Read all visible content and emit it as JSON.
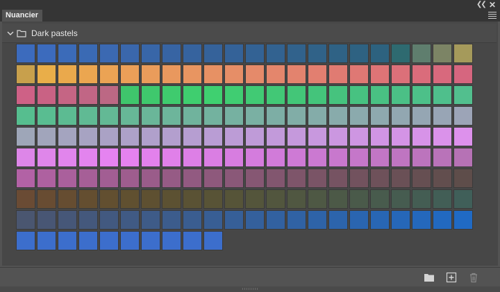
{
  "panel": {
    "tab_title": "Nuancier",
    "group_name": "Dark pastels"
  },
  "icons": {
    "collapse": "double-chevron-left-icon",
    "close": "close-icon",
    "menu": "hamburger-menu-icon",
    "expand": "chevron-down-icon",
    "folder": "folder-icon",
    "new_group": "new-folder-icon",
    "new_swatch": "add-icon",
    "delete": "trash-icon"
  },
  "swatches": [
    "#3c6bbd",
    "#3c6bbd",
    "#3b6bb9",
    "#3a6ab4",
    "#3b69b2",
    "#3a67ac",
    "#3866a8",
    "#3764a3",
    "#36639e",
    "#35629a",
    "#346298",
    "#336294",
    "#326290",
    "#31628c",
    "#306288",
    "#2f6285",
    "#2e6282",
    "#2d627f",
    "#2e6a70",
    "#5f7e6e",
    "#7c8465",
    "#a59a5b",
    "#c8a04c",
    "#e9ae49",
    "#eaa94c",
    "#eba650",
    "#eba354",
    "#eb9f58",
    "#ea9c5b",
    "#e9985e",
    "#e89561",
    "#e79164",
    "#e68e67",
    "#e58a6a",
    "#e4866c",
    "#e3836e",
    "#e27f70",
    "#e07b72",
    "#df7874",
    "#de7476",
    "#dc7079",
    "#da6c7b",
    "#d8697d",
    "#d6667f",
    "#ce6186",
    "#c96284",
    "#c56584",
    "#c16685",
    "#bc6884",
    "#3fc56c",
    "#3fc86d",
    "#3fcb6e",
    "#3fce6f",
    "#3fd070",
    "#40cd72",
    "#41ca74",
    "#42c876",
    "#43c678",
    "#44c47b",
    "#46c37e",
    "#47c281",
    "#49c183",
    "#4bc086",
    "#4dc089",
    "#4fbf8c",
    "#52bf8e",
    "#56be8f",
    "#59bd91",
    "#5cbb92",
    "#60ba94",
    "#63b995",
    "#67b797",
    "#6ab699",
    "#6db59b",
    "#70b39d",
    "#73b29f",
    "#76b1a1",
    "#7ab0a3",
    "#7daea5",
    "#81ada7",
    "#84aca9",
    "#88abab",
    "#8baaad",
    "#8ea9af",
    "#92a7b1",
    "#95a6b3",
    "#98a5b5",
    "#9ca4b7",
    "#9ea6b8",
    "#a1a5bb",
    "#a4a4bf",
    "#a7a3c2",
    "#aaa2c5",
    "#ada1c8",
    "#b0a0cb",
    "#b39fce",
    "#b69ed1",
    "#b99dd4",
    "#bc9cd6",
    "#bf9bd8",
    "#c29ada",
    "#c599dc",
    "#c898de",
    "#cb97e0",
    "#ce96e2",
    "#d195e4",
    "#d494e6",
    "#d793e8",
    "#da92ea",
    "#dd91ec",
    "#dd86e8",
    "#df86ea",
    "#e185ec",
    "#e384ee",
    "#e583f0",
    "#e582ef",
    "#e381ec",
    "#e080e9",
    "#dd7fe6",
    "#da7ee3",
    "#d77de0",
    "#d47cdd",
    "#d17bd9",
    "#ce7ad5",
    "#cb79d1",
    "#c878cd",
    "#c577c9",
    "#c276c5",
    "#bf75c1",
    "#bc74bd",
    "#b973b9",
    "#b672b5",
    "#b262a5",
    "#ae61a0",
    "#aa609c",
    "#a65f97",
    "#a25e93",
    "#9e5d8e",
    "#9a5c8a",
    "#965b85",
    "#925a81",
    "#8e597c",
    "#8a5878",
    "#865773",
    "#82566f",
    "#7e556a",
    "#7a5466",
    "#765362",
    "#72525e",
    "#6e515a",
    "#6a5056",
    "#664f52",
    "#624e4e",
    "#5e4d4a",
    "#6a4b34",
    "#684c32",
    "#664d31",
    "#644e30",
    "#624f30",
    "#605030",
    "#5e5031",
    "#5c5132",
    "#5a5234",
    "#585336",
    "#565438",
    "#54553b",
    "#52563e",
    "#505741",
    "#4e5844",
    "#4c5947",
    "#4a5a4a",
    "#485b4d",
    "#465c50",
    "#445d53",
    "#425e56",
    "#405f59",
    "#4a5670",
    "#485674",
    "#465778",
    "#44587c",
    "#425980",
    "#405a84",
    "#3e5b88",
    "#3c5c8c",
    "#3a5d90",
    "#385e94",
    "#365f98",
    "#34609c",
    "#3261a0",
    "#3062a4",
    "#2e63a8",
    "#2c64ac",
    "#2a65b0",
    "#2866b4",
    "#2667b8",
    "#2468bc",
    "#2269c0",
    "#206ac4",
    "#3c6ecc",
    "#3c6ecc",
    "#3c6ecc",
    "#3c6ecc",
    "#3c6ecc",
    "#3c6ecc",
    "#3c6ecc",
    "#3c6ecc",
    "#3c6ecc",
    "#3c6ecc"
  ]
}
